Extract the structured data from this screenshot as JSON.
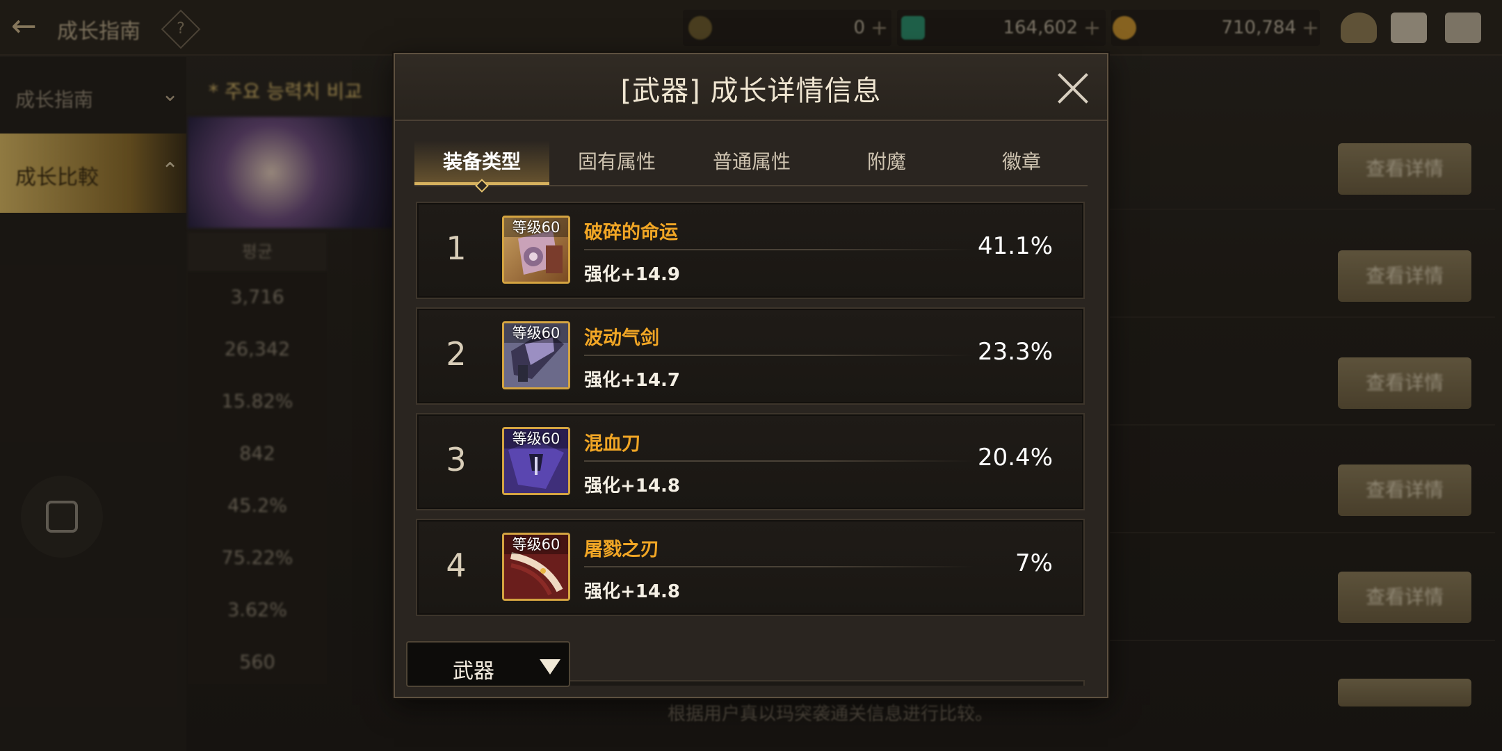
{
  "topbar": {
    "title": "成长指南",
    "help_symbol": "?",
    "currencies": [
      {
        "icon": "crescent-coin-icon",
        "value": "0"
      },
      {
        "icon": "gem-icon",
        "value": "164,602"
      },
      {
        "icon": "gold-coin-icon",
        "value": "710,784"
      }
    ],
    "plus_symbol": "+"
  },
  "leftnav": {
    "item1": "成长指南",
    "item2": "成长比較"
  },
  "background": {
    "subhead": "* 주요 능력치 비교",
    "stat_header": "평균",
    "stats": [
      "3,716",
      "26,342",
      "15.82%",
      "842",
      "45.2%",
      "75.22%",
      "3.62%",
      "560"
    ],
    "detail_button_label": "查看详情",
    "footnote": "根据用户真以玛突袭通关信息进行比较。"
  },
  "modal": {
    "title": "[武器] 成长详情信息",
    "tabs": [
      "装备类型",
      "固有属性",
      "普通属性",
      "附魔",
      "徽章"
    ],
    "active_tab": 0,
    "rows": [
      {
        "rank": "1",
        "level": "等级60",
        "name": "破碎的命运",
        "enhance": "强化+14.9",
        "percent": "41.1%"
      },
      {
        "rank": "2",
        "level": "等级60",
        "name": "波动气剑",
        "enhance": "强化+14.7",
        "percent": "23.3%"
      },
      {
        "rank": "3",
        "level": "等级60",
        "name": "混血刀",
        "enhance": "强化+14.8",
        "percent": "20.4%"
      },
      {
        "rank": "4",
        "level": "等级60",
        "name": "屠戮之刃",
        "enhance": "强化+14.8",
        "percent": "7%"
      }
    ],
    "dropdown_label": "武器"
  },
  "colors": {
    "accent_gold": "#d7b25e",
    "item_name": "#f1a625",
    "panel_bg": "#2a2520"
  }
}
